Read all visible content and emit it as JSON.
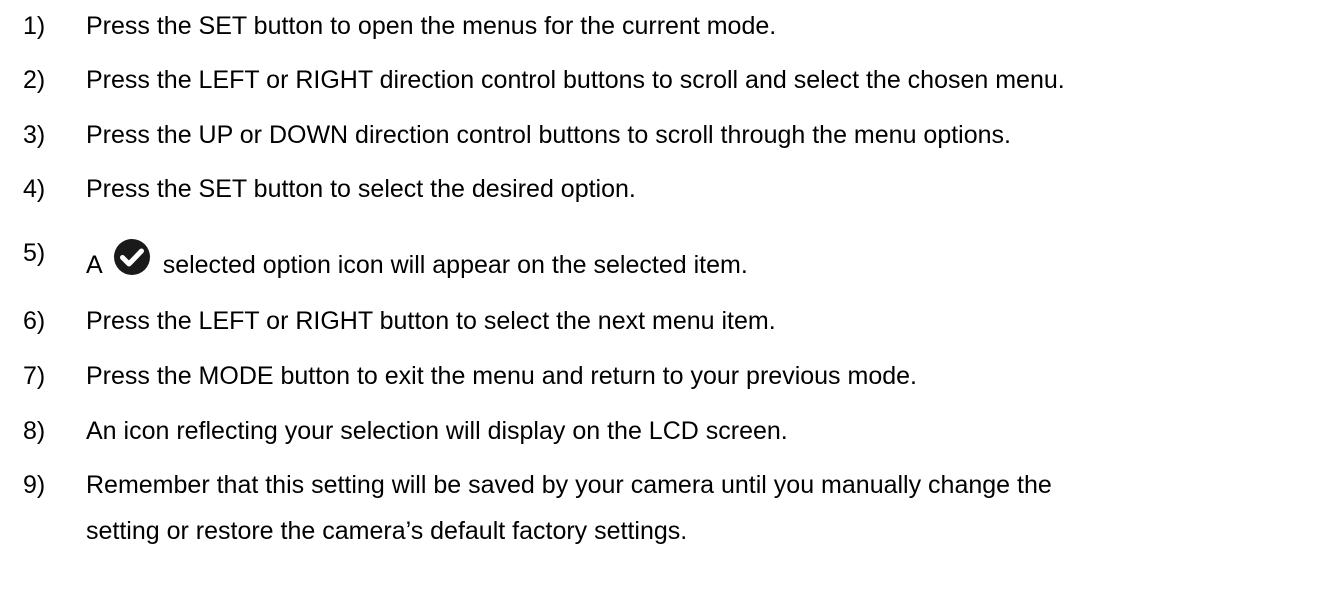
{
  "steps": [
    {
      "num": "1)",
      "text": "Press the SET button to open the menus for the current mode."
    },
    {
      "num": "2)",
      "text": "Press the LEFT or RIGHT direction control buttons to scroll and select the chosen menu."
    },
    {
      "num": "3)",
      "text": "Press the UP or DOWN direction control buttons to scroll through the menu options."
    },
    {
      "num": "4)",
      "text": "Press the SET button to select the desired option."
    },
    {
      "num": "5)",
      "text_before": "A",
      "icon": "check-circle-icon",
      "text_after": "selected option icon will appear on the selected item."
    },
    {
      "num": "6)",
      "text": "Press the LEFT or RIGHT button to select the next menu item."
    },
    {
      "num": "7)",
      "text": "Press the MODE button to exit the menu and return to your previous mode."
    },
    {
      "num": "8)",
      "text": "An icon reflecting your selection will display on the LCD screen."
    },
    {
      "num": "9)",
      "text": "Remember that this setting will be saved by your camera until you manually change the",
      "text_cont": "setting or restore the camera’s default factory settings."
    }
  ]
}
